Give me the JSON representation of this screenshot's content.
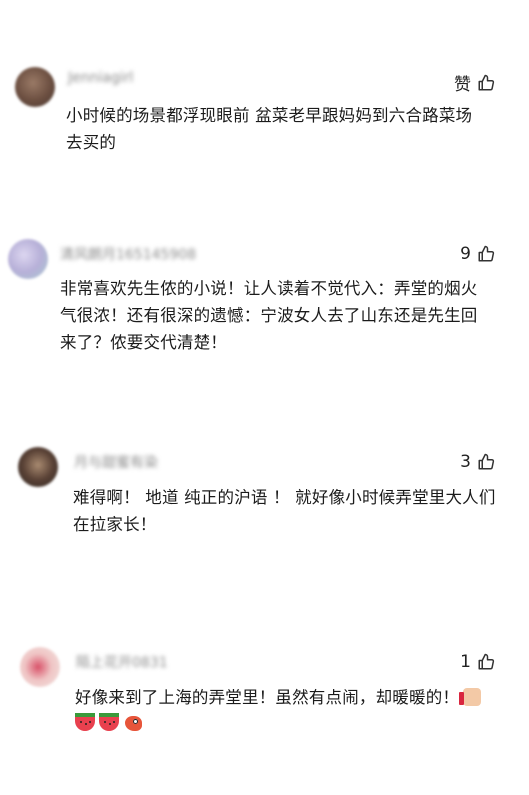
{
  "comments": [
    {
      "username": "Jenniagirl",
      "like_label": "赞",
      "text": [
        "小时候的场景都浮现眼前 盆菜老早跟妈妈到六合路菜场",
        "去买的"
      ],
      "avatar_color": "#7a5a4a"
    },
    {
      "username": "清风朗月165145908",
      "like_label": "9",
      "text": [
        "非常喜欢先生侬的小说！让人读着不觉代入：弄堂的烟火",
        "气很浓！还有很深的遗憾：宁波女人去了山东还是先生回",
        "来了？侬要交代清楚！"
      ],
      "avatar_color": "#b9b6d6"
    },
    {
      "username": "月与甜蜜有染",
      "like_label": "3",
      "text": [
        "难得啊！ 地道 纯正的沪语 ！ 就好像小时候弄堂里大人们",
        "在拉家长！"
      ],
      "avatar_color": "#4a3a30"
    },
    {
      "username": "陌上花开0831",
      "like_label": "1",
      "text": [
        "好像来到了上海的弄堂里！虽然有点闹，却暖暖的！"
      ],
      "avatar_color": "#e8d0c8"
    }
  ]
}
